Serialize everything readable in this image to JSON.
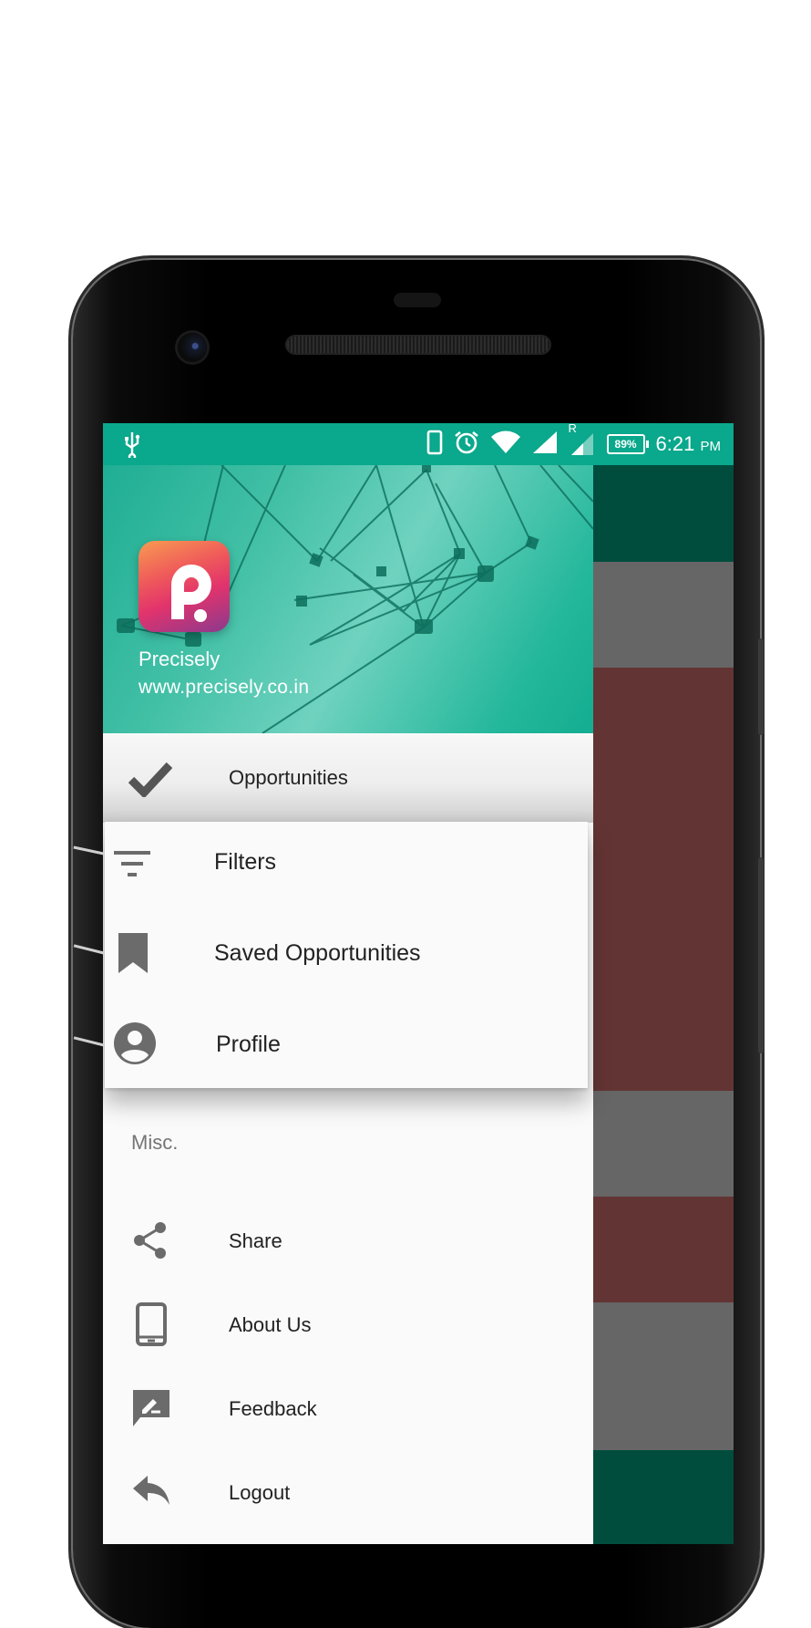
{
  "statusbar": {
    "battery": "89%",
    "time": "6:21",
    "ampm": "PM",
    "sim_label": "R",
    "icons": [
      "usb-icon",
      "phone-icon",
      "alarm-icon",
      "wifi-icon",
      "signal-icon",
      "signal-roaming-icon",
      "battery-icon"
    ]
  },
  "drawer": {
    "header": {
      "app_name": "Precisely",
      "url": "www.precisely.co.in"
    },
    "selected_item": {
      "label": "Opportunities",
      "icon": "check-icon"
    },
    "popup_items": [
      {
        "label": "Filters",
        "icon": "filter-icon"
      },
      {
        "label": "Saved Opportunities",
        "icon": "bookmark-icon"
      },
      {
        "label": "Profile",
        "icon": "account-circle-icon"
      }
    ],
    "section_label": "Misc.",
    "misc_items": [
      {
        "label": "Share",
        "icon": "share-icon"
      },
      {
        "label": "About Us",
        "icon": "tablet-icon"
      },
      {
        "label": "Feedback",
        "icon": "feedback-icon"
      },
      {
        "label": "Logout",
        "icon": "reply-icon"
      }
    ]
  },
  "colors": {
    "status_bar": "#0aa88c",
    "drawer_header_accent": "#42c0a6",
    "background_dark_green": "#004d3e",
    "background_red_row": "#633434",
    "background_gray_row": "#666666",
    "icon_gray": "#6b6b6b"
  }
}
